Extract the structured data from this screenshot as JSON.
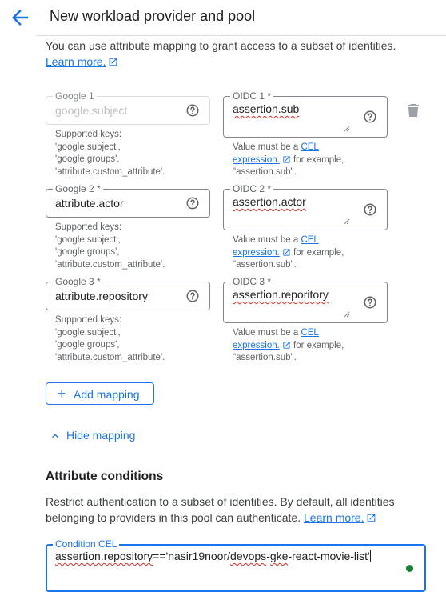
{
  "header": {
    "title": "New workload provider and pool"
  },
  "intro": {
    "text": "You can use attribute mapping to grant access to a subset of identities.",
    "learn_more": "Learn more."
  },
  "mappings": [
    {
      "google": {
        "label": "Google 1",
        "value": "google.subject",
        "disabled": true
      },
      "google_hint": [
        "Supported keys:",
        "'google.subject',",
        "'google.groups',",
        "'attribute.custom_attribute'."
      ],
      "oidc": {
        "label": "OIDC 1 *",
        "value": "assertion.sub"
      },
      "oidc_hint": {
        "prefix": "Value must be a ",
        "link1": "CEL",
        "link2": "expression.",
        "suffix": " for example,",
        "example": "\"assertion.sub\"."
      }
    },
    {
      "google": {
        "label": "Google 2 *",
        "value": "attribute.actor",
        "disabled": false
      },
      "google_hint": [
        "Supported keys:",
        "'google.subject',",
        "'google.groups',",
        "'attribute.custom_attribute'."
      ],
      "oidc": {
        "label": "OIDC 2 *",
        "value": "assertion.actor"
      },
      "oidc_hint": {
        "prefix": "Value must be a ",
        "link1": "CEL",
        "link2": "expression.",
        "suffix": " for example,",
        "example": "\"assertion.sub\"."
      }
    },
    {
      "google": {
        "label": "Google 3 *",
        "value": "attribute.repository",
        "disabled": false
      },
      "google_hint": [
        "Supported keys:",
        "'google.subject',",
        "'google.groups',",
        "'attribute.custom_attribute'."
      ],
      "oidc": {
        "label": "OIDC 3 *",
        "value": "assertion.reporitory"
      },
      "oidc_hint": {
        "prefix": "Value must be a ",
        "link1": "CEL",
        "link2": "expression.",
        "suffix": " for example,",
        "example": "\"assertion.sub\"."
      }
    }
  ],
  "actions": {
    "add_mapping": "Add mapping",
    "hide_mapping": "Hide mapping"
  },
  "conditions": {
    "title": "Attribute conditions",
    "description": "Restrict authentication to a subset of identities. By default, all identities belonging to providers in this pool can authenticate.",
    "learn_more": "Learn more.",
    "field_label": "Condition CEL",
    "value_prefix": "assertion.repository",
    "value_middle": "=='nasir19noor/",
    "value_err1": "devops",
    "value_dash": "-",
    "value_err2": "gke",
    "value_suffix": "-react-movie-list'"
  },
  "colors": {
    "accent": "#1a73e8",
    "error_underline": "#d93025",
    "status_ok": "#188038"
  },
  "icons": {
    "back": "arrow-back-icon",
    "external": "open-in-new-icon",
    "help": "help-circle-icon",
    "delete": "trash-icon",
    "add": "plus-icon",
    "collapse": "chevron-up-icon",
    "resize": "resize-handle-icon"
  }
}
